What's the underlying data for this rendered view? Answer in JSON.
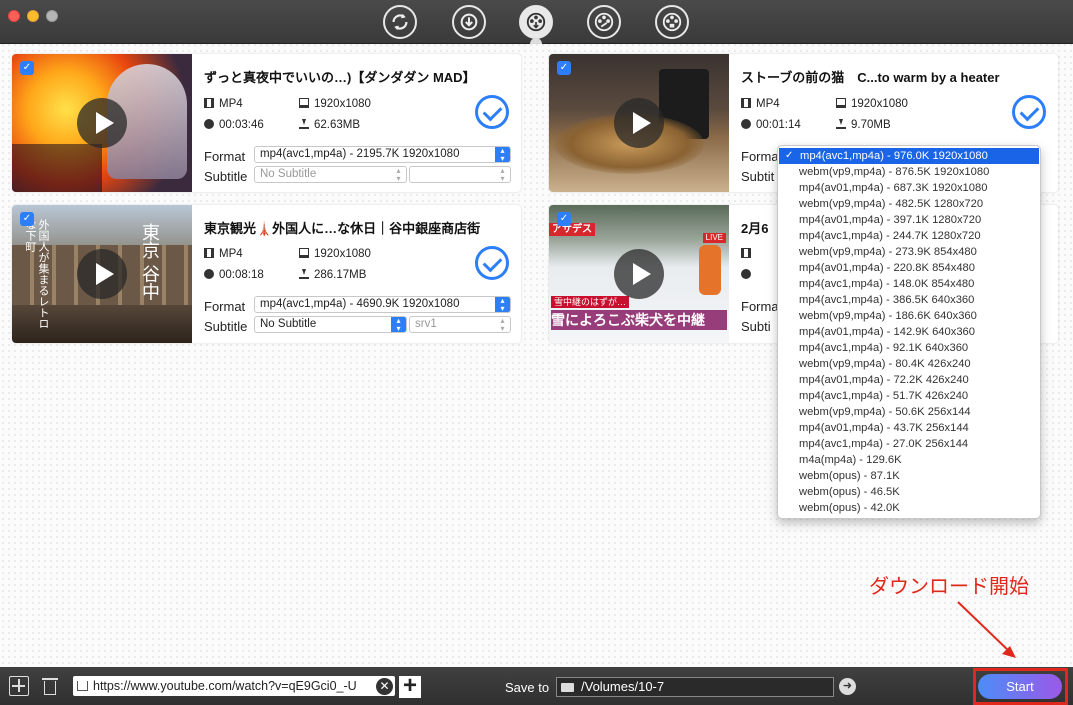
{
  "toolbar": {
    "tabs": [
      "convert-icon",
      "download-icon",
      "video-download-icon",
      "video-edit-icon",
      "video-record-icon"
    ]
  },
  "cards": [
    {
      "title": "ずっと真夜中でいいの…)【ダンダダン MAD】",
      "container": "MP4",
      "resolution": "1920x1080",
      "duration": "00:03:46",
      "size": "62.63MB",
      "format_label": "Format",
      "format_value": "mp4(avc1,mp4a) - 2195.7K 1920x1080",
      "subtitle_label": "Subtitle",
      "subtitle_value": "No Subtitle",
      "subtitle_extra": ""
    },
    {
      "title": "ストーブの前の猫　C...to warm by a heater",
      "container": "MP4",
      "resolution": "1920x1080",
      "duration": "00:01:14",
      "size": "9.70MB",
      "format_label": "Forma",
      "subtitle_label": "Subtit"
    },
    {
      "title": "東京観光🗼外国人に…な休日｜谷中銀座商店街",
      "container": "MP4",
      "resolution": "1920x1080",
      "duration": "00:08:18",
      "size": "286.17MB",
      "format_label": "Format",
      "format_value": "mp4(avc1,mp4a) - 4690.9K 1920x1080",
      "subtitle_label": "Subtitle",
      "subtitle_value": "No Subtitle",
      "subtitle_extra": "srv1",
      "thumb_text": "東京 谷中",
      "thumb_text2": "外国人が集まるレトロな下町"
    },
    {
      "title": "2月6",
      "format_label": "Forma",
      "subtitle_label": "Subti",
      "thumb_banner": "アサデス",
      "thumb_live": "LIVE",
      "thumb_caption1": "雪中継のはずが…",
      "thumb_caption2": "雪によろこぶ柴犬を中継"
    }
  ],
  "dropdown": {
    "selected": "mp4(avc1,mp4a) - 976.0K 1920x1080",
    "options": [
      "webm(vp9,mp4a) - 876.5K 1920x1080",
      "mp4(av01,mp4a) - 687.3K 1920x1080",
      "webm(vp9,mp4a) - 482.5K 1280x720",
      "mp4(av01,mp4a) - 397.1K 1280x720",
      "mp4(avc1,mp4a) - 244.7K 1280x720",
      "webm(vp9,mp4a) - 273.9K 854x480",
      "mp4(av01,mp4a) - 220.8K 854x480",
      "mp4(avc1,mp4a) - 148.0K 854x480",
      "mp4(avc1,mp4a) - 386.5K 640x360",
      "webm(vp9,mp4a) - 186.6K 640x360",
      "mp4(av01,mp4a) - 142.9K 640x360",
      "mp4(avc1,mp4a) - 92.1K 640x360",
      "webm(vp9,mp4a) - 80.4K 426x240",
      "mp4(av01,mp4a) - 72.2K 426x240",
      "mp4(avc1,mp4a) - 51.7K 426x240",
      "webm(vp9,mp4a) - 50.6K 256x144",
      "mp4(av01,mp4a) - 43.7K 256x144",
      "mp4(avc1,mp4a) - 27.0K 256x144",
      "m4a(mp4a) - 129.6K",
      "webm(opus) - 87.1K",
      "webm(opus) - 46.5K",
      "webm(opus) - 42.0K"
    ]
  },
  "bottom": {
    "url": "https://www.youtube.com/watch?v=qE9Gci0_-U",
    "save_to_label": "Save to",
    "save_path": "/Volumes/10-7",
    "start_label": "Start"
  },
  "annotation": "ダウンロード開始",
  "colors": {
    "accent": "#2d7ff9",
    "annotation_red": "#e0281c"
  }
}
